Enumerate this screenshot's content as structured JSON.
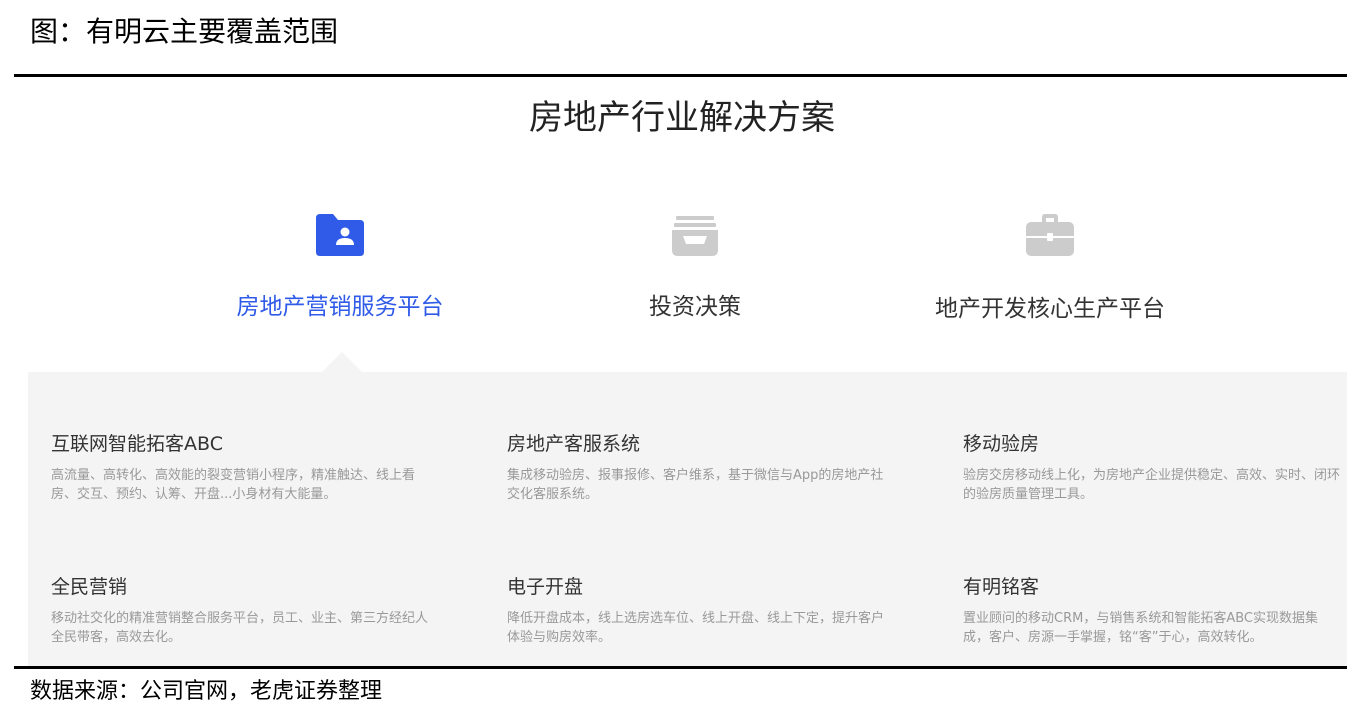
{
  "figure": {
    "caption": "图：有明云主要覆盖范围",
    "source": "数据来源：公司官网，老虎证券整理"
  },
  "section": {
    "title": "房地产行业解决方案"
  },
  "tabs": [
    {
      "label": "房地产营销服务平台",
      "icon": "folder-user-icon",
      "active": true
    },
    {
      "label": "投资决策",
      "icon": "inbox-tray-icon",
      "active": false
    },
    {
      "label": "地产开发核心生产平台",
      "icon": "briefcase-icon",
      "active": false
    }
  ],
  "cards": [
    {
      "title": "互联网智能拓客ABC",
      "desc": "高流量、高转化、高效能的裂变营销小程序，精准触达、线上看房、交互、预约、认筹、开盘...小身材有大能量。"
    },
    {
      "title": "房地产客服系统",
      "desc": "集成移动验房、报事报修、客户维系，基于微信与App的房地产社交化客服系统。"
    },
    {
      "title": "移动验房",
      "desc": "验房交房移动线上化，为房地产企业提供稳定、高效、实时、闭环的验房质量管理工具。"
    },
    {
      "title": "全民营销",
      "desc": "移动社交化的精准营销整合服务平台，员工、业主、第三方经纪人全民带客，高效去化。"
    },
    {
      "title": "电子开盘",
      "desc": "降低开盘成本，线上选房选车位、线上开盘、线上下定，提升客户体验与购房效率。"
    },
    {
      "title": "有明铭客",
      "desc": "置业顾问的移动CRM，与销售系统和智能拓客ABC实现数据集成，客户、房源一手掌握，铭“客”于心，高效转化。"
    }
  ],
  "colors": {
    "accent": "#2f5be8",
    "inactive_icon": "#cccccc",
    "panel_bg": "#f4f4f4"
  }
}
